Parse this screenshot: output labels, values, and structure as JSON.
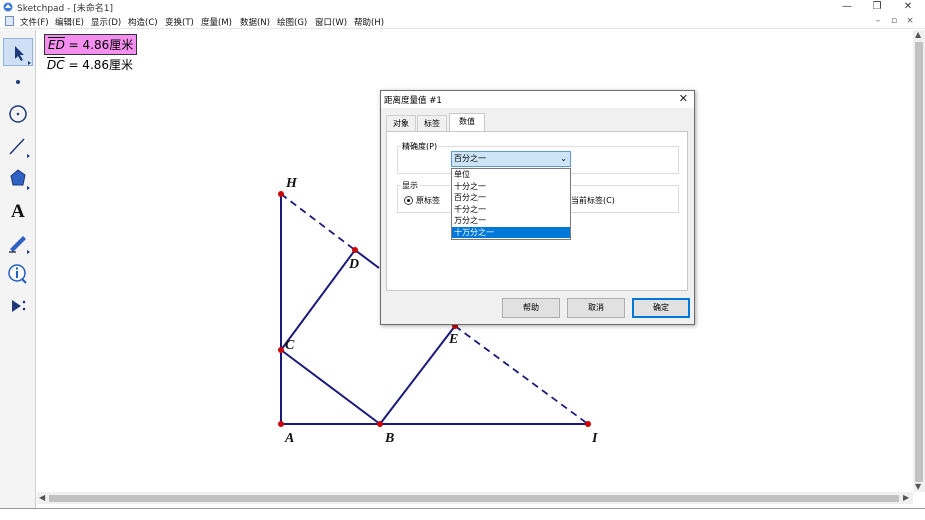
{
  "window": {
    "title": "Sketchpad  - [未命名1]",
    "controls": {
      "minimize": "—",
      "restore": "❐",
      "close": "✕"
    }
  },
  "menubar": {
    "items": [
      "文件(F)",
      "编辑(E)",
      "显示(D)",
      "构造(C)",
      "变换(T)",
      "度量(M)",
      "数据(N)",
      "绘图(G)",
      "窗口(W)",
      "帮助(H)"
    ],
    "mdi": {
      "minimize": "–",
      "restore": "▫",
      "close": "×"
    }
  },
  "toolbox": {
    "tools": [
      "arrow-select",
      "point",
      "compass",
      "straightedge",
      "polygon",
      "text",
      "marker",
      "information",
      "custom-tools"
    ],
    "text_tool_glyph": "A",
    "custom_tool_glyph": "▶⁞"
  },
  "measurements": [
    {
      "var": "ED",
      "value": " = 4.86",
      "unit": "厘米",
      "selected": true
    },
    {
      "var": "DC",
      "value": " = 4.86",
      "unit": "厘米",
      "selected": false
    }
  ],
  "figure": {
    "point_color": "#cc0000",
    "line_color": "#1a1a7a",
    "labels": {
      "H": "H",
      "D": "D",
      "C": "C",
      "E": "E",
      "A": "A",
      "B": "B",
      "I": "I"
    }
  },
  "dialog": {
    "title": "距离度量值 #1",
    "close": "✕",
    "tabs": [
      "对象",
      "标签",
      "数值"
    ],
    "active_tab": 2,
    "precision_label": "精确度(P)",
    "precision_value": "百分之一",
    "precision_options": [
      "单位",
      "十分之一",
      "百分之一",
      "千分之一",
      "万分之一",
      "十万分之一"
    ],
    "highlighted_option": 5,
    "display_group_label": "显示",
    "radio_original_label": "原标签",
    "radio_current_label": "当前标签(C)",
    "buttons": {
      "help": "帮助",
      "cancel": "取消",
      "ok": "确定"
    }
  }
}
